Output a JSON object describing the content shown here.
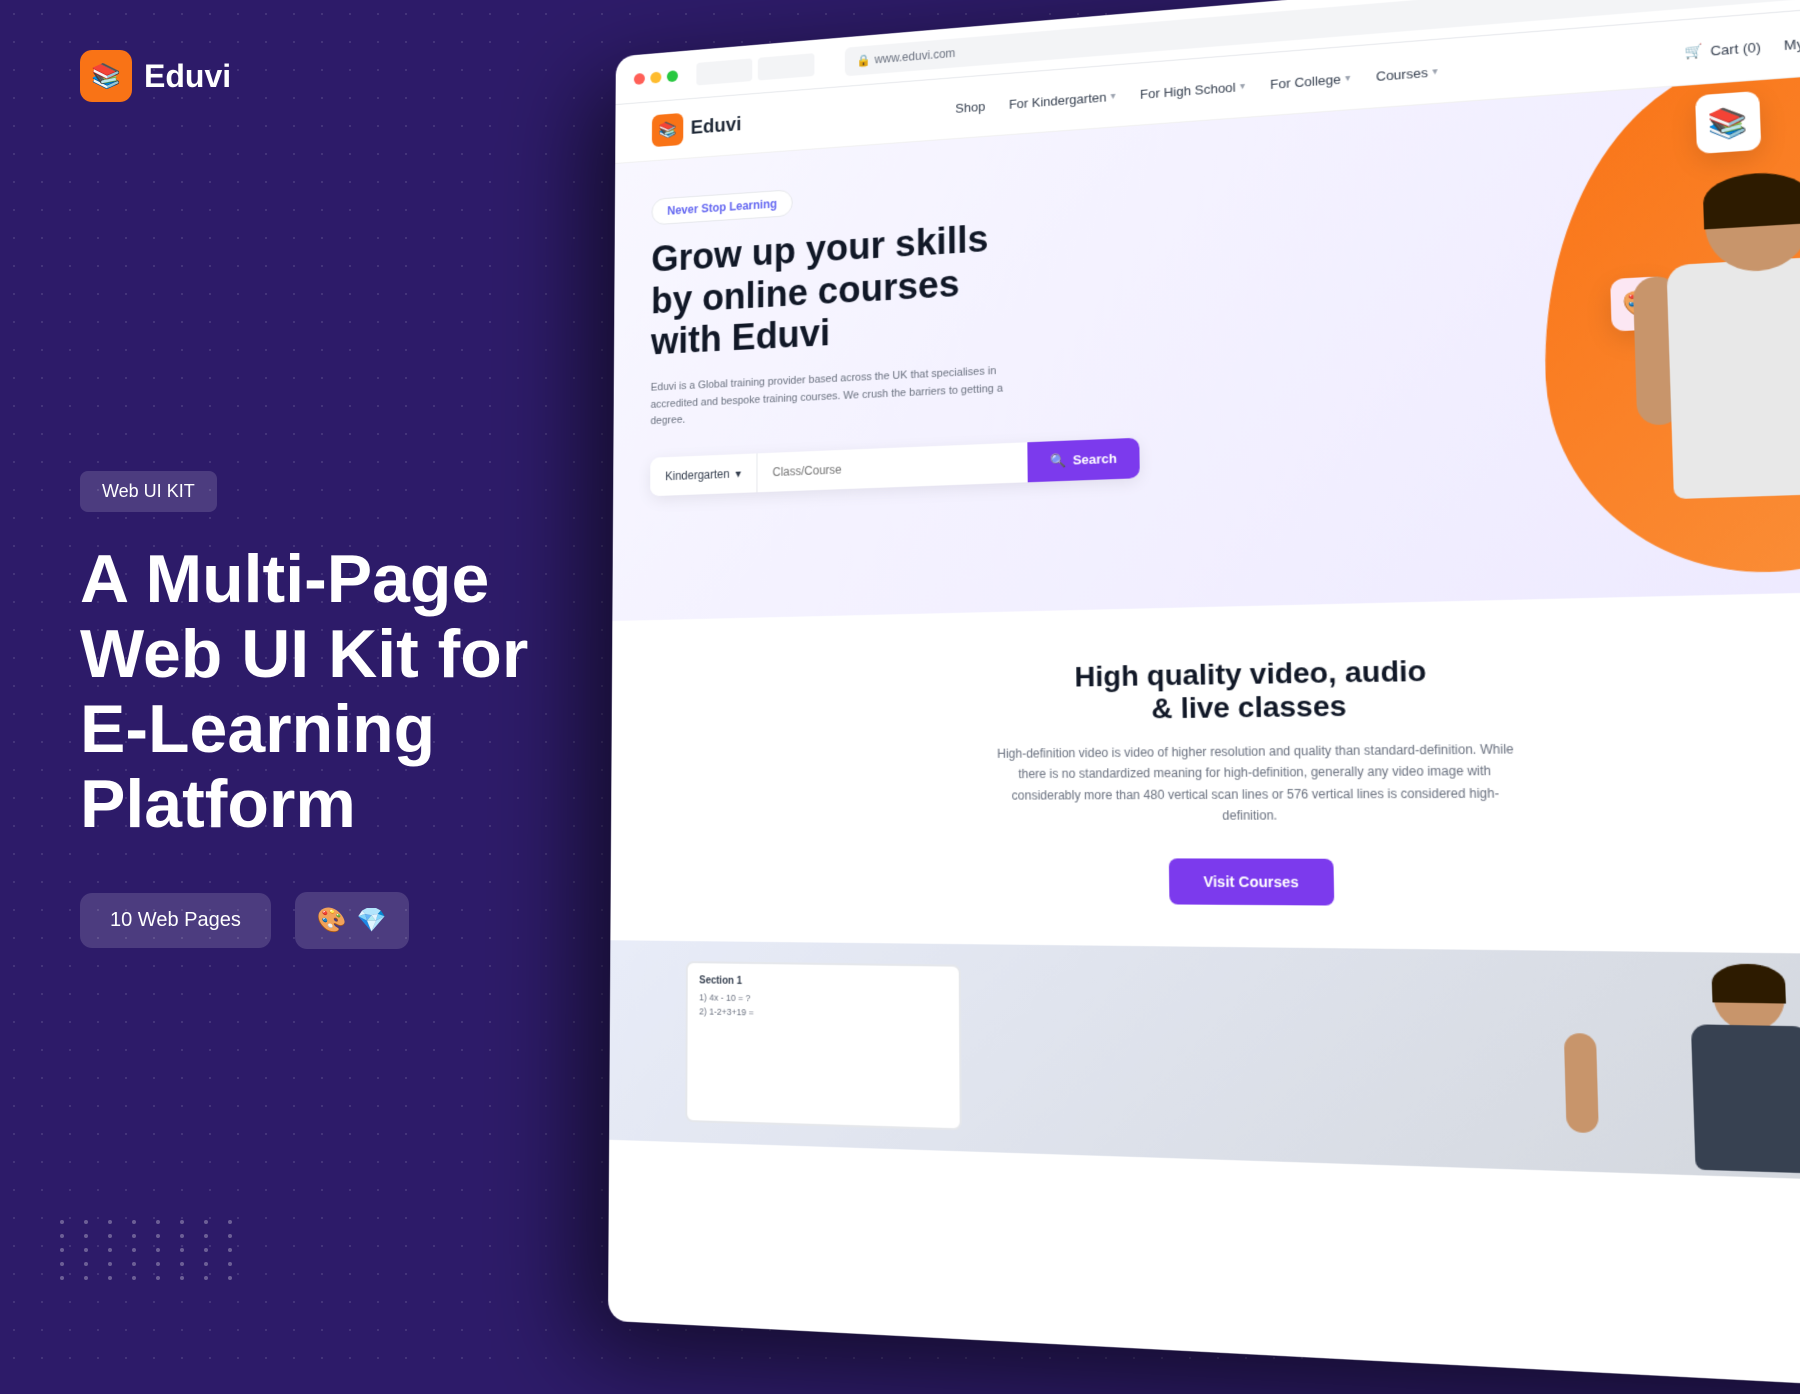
{
  "app": {
    "title": "Eduvi - A Multi-Page Web UI Kit for E-Learning Platform"
  },
  "left": {
    "logo": {
      "icon": "📚",
      "text": "Eduvi"
    },
    "badge": "Web UI KIT",
    "headline": "A Multi-Page\nWeb UI Kit for\nE-Learning\nPlatform",
    "pages_badge": "10 Web Pages",
    "tool_icons": "🎨💎"
  },
  "site": {
    "logo": {
      "icon": "📚",
      "text": "Eduvi"
    },
    "nav": {
      "shop": "Shop",
      "kindergarten": "For Kindergarten",
      "high_school": "For High School",
      "college": "For College",
      "courses": "Courses"
    },
    "cart": "Cart (0)",
    "account": "My Account",
    "hero": {
      "badge": "Never Stop Learning",
      "headline": "Grow up your skills\nby online courses\nwith Eduvi",
      "subtext": "Eduvi is a Global training provider based across the UK that specialises in accredited and bespoke training courses. We crush the barriers to getting a degree.",
      "search_select": "Kindergarten",
      "search_placeholder": "Class/Course",
      "search_btn": "Search"
    },
    "quality": {
      "title": "High quality video, audio\n& live classes",
      "text": "High-definition video is video of higher resolution and quality than standard-definition. While there is no standardized meaning for high-definition, generally any video image with considerably more than 480 vertical scan lines or 576 vertical lines is considered high-definition.",
      "visit_btn": "Visit Courses"
    }
  }
}
